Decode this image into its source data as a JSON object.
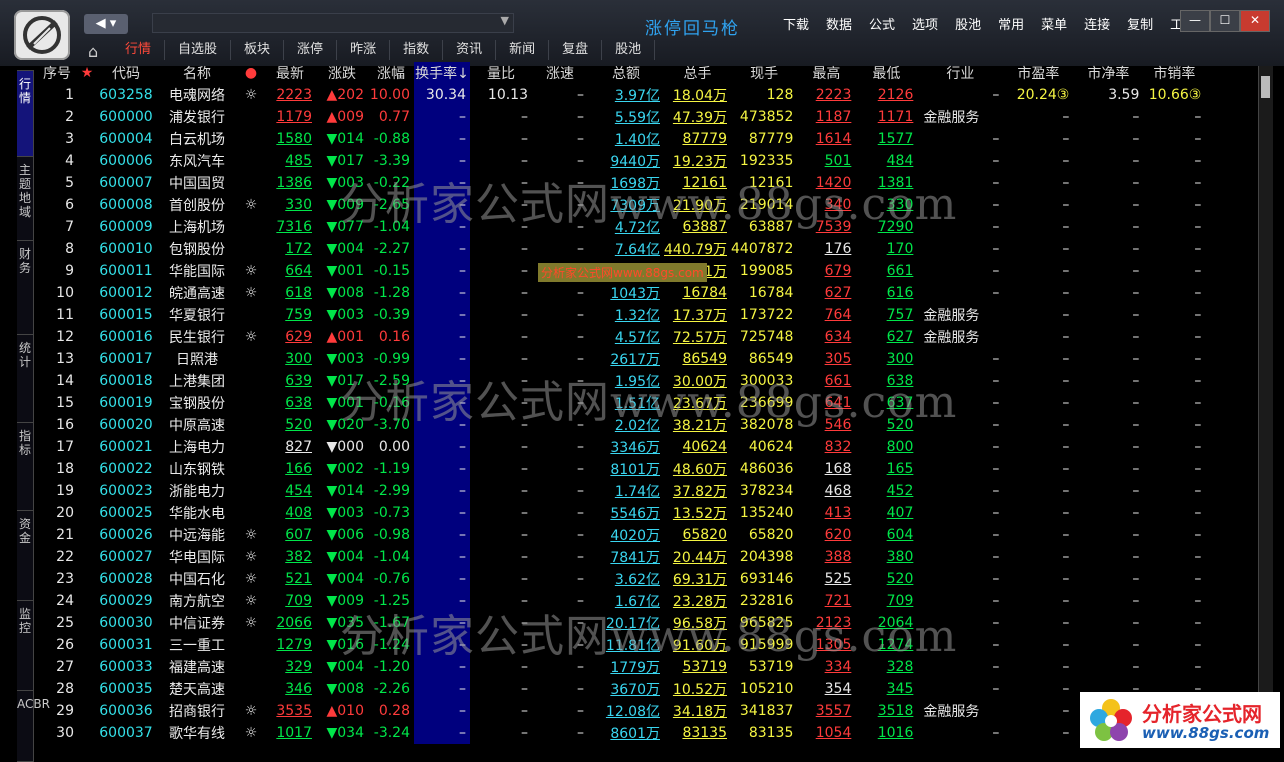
{
  "app": {
    "title": "涨停回马枪",
    "menu": [
      "下载",
      "数据",
      "公式",
      "选项",
      "股池",
      "常用",
      "菜单",
      "连接",
      "复制",
      "工具"
    ],
    "window_buttons": [
      "—",
      "☐",
      "✕"
    ],
    "nav_arrows": "◀ ▾"
  },
  "tabs": [
    {
      "label": "行情",
      "active": true
    },
    {
      "label": "自选股",
      "active": false
    },
    {
      "label": "板块",
      "active": false
    },
    {
      "label": "涨停",
      "active": false
    },
    {
      "label": "昨涨",
      "active": false
    },
    {
      "label": "指数",
      "active": false
    },
    {
      "label": "资讯",
      "active": false
    },
    {
      "label": "新闻",
      "active": false
    },
    {
      "label": "复盘",
      "active": false
    },
    {
      "label": "股池",
      "active": false
    }
  ],
  "sidebar": [
    {
      "label": "行情",
      "active": true
    },
    {
      "label": "主题地域",
      "active": false
    },
    {
      "label": "财务",
      "active": false
    },
    {
      "label": "统计",
      "active": false
    },
    {
      "label": "指标",
      "active": false
    },
    {
      "label": "资金",
      "active": false
    },
    {
      "label": "监控",
      "active": false
    },
    {
      "label": "ACBR",
      "active": false
    }
  ],
  "columns": [
    "序号",
    "★",
    "代码",
    "名称",
    "●",
    "最新",
    "涨跌",
    "涨幅",
    "换手率↓",
    "量比",
    "涨速",
    "总额",
    "总手",
    "现手",
    "最高",
    "最低",
    "行业",
    "市盈率",
    "市净率",
    "市销率"
  ],
  "rows": [
    {
      "idx": "1",
      "code": "603258",
      "name": "电魂网络",
      "mark": "☼",
      "last": "2223",
      "chg": "▲202",
      "pct": "10.00",
      "turn": "30.34",
      "vr": "10.13",
      "spd": "–",
      "amt": "3.97亿",
      "vol": "18.04万",
      "cur": "128",
      "high": "2223",
      "low": "2126",
      "ind": "–",
      "pe": "20.24③",
      "pb": "3.59",
      "ps": "10.66③",
      "dir": "up",
      "hc": "red",
      "lc": "red"
    },
    {
      "idx": "2",
      "code": "600000",
      "name": "浦发银行",
      "mark": "",
      "last": "1179",
      "chg": "▲009",
      "pct": "0.77",
      "turn": "–",
      "vr": "–",
      "spd": "–",
      "amt": "5.59亿",
      "vol": "47.39万",
      "cur": "473852",
      "high": "1187",
      "low": "1171",
      "ind": "金融服务",
      "pe": "–",
      "pb": "–",
      "ps": "–",
      "dir": "up",
      "hc": "red",
      "lc": "red"
    },
    {
      "idx": "3",
      "code": "600004",
      "name": "白云机场",
      "mark": "",
      "last": "1580",
      "chg": "▼014",
      "pct": "-0.88",
      "turn": "–",
      "vr": "–",
      "spd": "–",
      "amt": "1.40亿",
      "vol": "87779",
      "cur": "87779",
      "high": "1614",
      "low": "1577",
      "ind": "–",
      "pe": "–",
      "pb": "–",
      "ps": "–",
      "dir": "dn",
      "hc": "red",
      "lc": "grn"
    },
    {
      "idx": "4",
      "code": "600006",
      "name": "东风汽车",
      "mark": "",
      "last": "485",
      "chg": "▼017",
      "pct": "-3.39",
      "turn": "–",
      "vr": "–",
      "spd": "–",
      "amt": "9440万",
      "vol": "19.23万",
      "cur": "192335",
      "high": "501",
      "low": "484",
      "ind": "–",
      "pe": "–",
      "pb": "–",
      "ps": "–",
      "dir": "dn",
      "hc": "grn",
      "lc": "grn"
    },
    {
      "idx": "5",
      "code": "600007",
      "name": "中国国贸",
      "mark": "",
      "last": "1386",
      "chg": "▼003",
      "pct": "-0.22",
      "turn": "–",
      "vr": "–",
      "spd": "–",
      "amt": "1698万",
      "vol": "12161",
      "cur": "12161",
      "high": "1420",
      "low": "1381",
      "ind": "–",
      "pe": "–",
      "pb": "–",
      "ps": "–",
      "dir": "dn",
      "hc": "red",
      "lc": "grn"
    },
    {
      "idx": "6",
      "code": "600008",
      "name": "首创股份",
      "mark": "☼",
      "last": "330",
      "chg": "▼009",
      "pct": "-2.65",
      "turn": "–",
      "vr": "–",
      "spd": "–",
      "amt": "7309万",
      "vol": "21.90万",
      "cur": "219014",
      "high": "340",
      "low": "330",
      "ind": "–",
      "pe": "–",
      "pb": "–",
      "ps": "–",
      "dir": "dn",
      "hc": "red",
      "lc": "grn"
    },
    {
      "idx": "7",
      "code": "600009",
      "name": "上海机场",
      "mark": "",
      "last": "7316",
      "chg": "▼077",
      "pct": "-1.04",
      "turn": "–",
      "vr": "–",
      "spd": "–",
      "amt": "4.72亿",
      "vol": "63887",
      "cur": "63887",
      "high": "7539",
      "low": "7290",
      "ind": "–",
      "pe": "–",
      "pb": "–",
      "ps": "–",
      "dir": "dn",
      "hc": "red",
      "lc": "grn"
    },
    {
      "idx": "8",
      "code": "600010",
      "name": "包钢股份",
      "mark": "",
      "last": "172",
      "chg": "▼004",
      "pct": "-2.27",
      "turn": "–",
      "vr": "–",
      "spd": "–",
      "amt": "7.64亿",
      "vol": "440.79万",
      "cur": "4407872",
      "high": "176",
      "low": "170",
      "ind": "–",
      "pe": "–",
      "pb": "–",
      "ps": "–",
      "dir": "dn",
      "hc": "wht",
      "lc": "grn"
    },
    {
      "idx": "9",
      "code": "600011",
      "name": "华能国际",
      "mark": "☼",
      "last": "664",
      "chg": "▼001",
      "pct": "-0.15",
      "turn": "–",
      "vr": "–",
      "spd": "–",
      "amt": "1.33亿",
      "vol": "19.91万",
      "cur": "199085",
      "high": "679",
      "low": "661",
      "ind": "–",
      "pe": "–",
      "pb": "–",
      "ps": "–",
      "dir": "dn",
      "hc": "red",
      "lc": "grn"
    },
    {
      "idx": "10",
      "code": "600012",
      "name": "皖通高速",
      "mark": "☼",
      "last": "618",
      "chg": "▼008",
      "pct": "-1.28",
      "turn": "–",
      "vr": "–",
      "spd": "–",
      "amt": "1043万",
      "vol": "16784",
      "cur": "16784",
      "high": "627",
      "low": "616",
      "ind": "–",
      "pe": "–",
      "pb": "–",
      "ps": "–",
      "dir": "dn",
      "hc": "red",
      "lc": "grn"
    },
    {
      "idx": "11",
      "code": "600015",
      "name": "华夏银行",
      "mark": "",
      "last": "759",
      "chg": "▼003",
      "pct": "-0.39",
      "turn": "–",
      "vr": "–",
      "spd": "–",
      "amt": "1.32亿",
      "vol": "17.37万",
      "cur": "173722",
      "high": "764",
      "low": "757",
      "ind": "金融服务",
      "pe": "–",
      "pb": "–",
      "ps": "–",
      "dir": "dn",
      "hc": "red",
      "lc": "grn"
    },
    {
      "idx": "12",
      "code": "600016",
      "name": "民生银行",
      "mark": "☼",
      "last": "629",
      "chg": "▲001",
      "pct": "0.16",
      "turn": "–",
      "vr": "–",
      "spd": "–",
      "amt": "4.57亿",
      "vol": "72.57万",
      "cur": "725748",
      "high": "634",
      "low": "627",
      "ind": "金融服务",
      "pe": "–",
      "pb": "–",
      "ps": "–",
      "dir": "up",
      "hc": "red",
      "lc": "grn"
    },
    {
      "idx": "13",
      "code": "600017",
      "name": "日照港",
      "mark": "",
      "last": "300",
      "chg": "▼003",
      "pct": "-0.99",
      "turn": "–",
      "vr": "–",
      "spd": "–",
      "amt": "2617万",
      "vol": "86549",
      "cur": "86549",
      "high": "305",
      "low": "300",
      "ind": "–",
      "pe": "–",
      "pb": "–",
      "ps": "–",
      "dir": "dn",
      "hc": "red",
      "lc": "grn"
    },
    {
      "idx": "14",
      "code": "600018",
      "name": "上港集团",
      "mark": "",
      "last": "639",
      "chg": "▼017",
      "pct": "-2.59",
      "turn": "–",
      "vr": "–",
      "spd": "–",
      "amt": "1.95亿",
      "vol": "30.00万",
      "cur": "300033",
      "high": "661",
      "low": "638",
      "ind": "–",
      "pe": "–",
      "pb": "–",
      "ps": "–",
      "dir": "dn",
      "hc": "red",
      "lc": "grn"
    },
    {
      "idx": "15",
      "code": "600019",
      "name": "宝钢股份",
      "mark": "",
      "last": "638",
      "chg": "▼001",
      "pct": "-0.16",
      "turn": "–",
      "vr": "–",
      "spd": "–",
      "amt": "1.51亿",
      "vol": "23.67万",
      "cur": "236699",
      "high": "641",
      "low": "637",
      "ind": "–",
      "pe": "–",
      "pb": "–",
      "ps": "–",
      "dir": "dn",
      "hc": "red",
      "lc": "grn"
    },
    {
      "idx": "16",
      "code": "600020",
      "name": "中原高速",
      "mark": "",
      "last": "520",
      "chg": "▼020",
      "pct": "-3.70",
      "turn": "–",
      "vr": "–",
      "spd": "–",
      "amt": "2.02亿",
      "vol": "38.21万",
      "cur": "382078",
      "high": "546",
      "low": "520",
      "ind": "–",
      "pe": "–",
      "pb": "–",
      "ps": "–",
      "dir": "dn",
      "hc": "red",
      "lc": "grn"
    },
    {
      "idx": "17",
      "code": "600021",
      "name": "上海电力",
      "mark": "",
      "last": "827",
      "chg": "▼000",
      "pct": "0.00",
      "turn": "–",
      "vr": "–",
      "spd": "–",
      "amt": "3346万",
      "vol": "40624",
      "cur": "40624",
      "high": "832",
      "low": "800",
      "ind": "–",
      "pe": "–",
      "pb": "–",
      "ps": "–",
      "dir": "eq",
      "hc": "red",
      "lc": "grn"
    },
    {
      "idx": "18",
      "code": "600022",
      "name": "山东钢铁",
      "mark": "",
      "last": "166",
      "chg": "▼002",
      "pct": "-1.19",
      "turn": "–",
      "vr": "–",
      "spd": "–",
      "amt": "8101万",
      "vol": "48.60万",
      "cur": "486036",
      "high": "168",
      "low": "165",
      "ind": "–",
      "pe": "–",
      "pb": "–",
      "ps": "–",
      "dir": "dn",
      "hc": "wht",
      "lc": "grn"
    },
    {
      "idx": "19",
      "code": "600023",
      "name": "浙能电力",
      "mark": "",
      "last": "454",
      "chg": "▼014",
      "pct": "-2.99",
      "turn": "–",
      "vr": "–",
      "spd": "–",
      "amt": "1.74亿",
      "vol": "37.82万",
      "cur": "378234",
      "high": "468",
      "low": "452",
      "ind": "–",
      "pe": "–",
      "pb": "–",
      "ps": "–",
      "dir": "dn",
      "hc": "wht",
      "lc": "grn"
    },
    {
      "idx": "20",
      "code": "600025",
      "name": "华能水电",
      "mark": "",
      "last": "408",
      "chg": "▼003",
      "pct": "-0.73",
      "turn": "–",
      "vr": "–",
      "spd": "–",
      "amt": "5546万",
      "vol": "13.52万",
      "cur": "135240",
      "high": "413",
      "low": "407",
      "ind": "–",
      "pe": "–",
      "pb": "–",
      "ps": "–",
      "dir": "dn",
      "hc": "red",
      "lc": "grn"
    },
    {
      "idx": "21",
      "code": "600026",
      "name": "中远海能",
      "mark": "☼",
      "last": "607",
      "chg": "▼006",
      "pct": "-0.98",
      "turn": "–",
      "vr": "–",
      "spd": "–",
      "amt": "4020万",
      "vol": "65820",
      "cur": "65820",
      "high": "620",
      "low": "604",
      "ind": "–",
      "pe": "–",
      "pb": "–",
      "ps": "–",
      "dir": "dn",
      "hc": "red",
      "lc": "grn"
    },
    {
      "idx": "22",
      "code": "600027",
      "name": "华电国际",
      "mark": "☼",
      "last": "382",
      "chg": "▼004",
      "pct": "-1.04",
      "turn": "–",
      "vr": "–",
      "spd": "–",
      "amt": "7841万",
      "vol": "20.44万",
      "cur": "204398",
      "high": "388",
      "low": "380",
      "ind": "–",
      "pe": "–",
      "pb": "–",
      "ps": "–",
      "dir": "dn",
      "hc": "red",
      "lc": "grn"
    },
    {
      "idx": "23",
      "code": "600028",
      "name": "中国石化",
      "mark": "☼",
      "last": "521",
      "chg": "▼004",
      "pct": "-0.76",
      "turn": "–",
      "vr": "–",
      "spd": "–",
      "amt": "3.62亿",
      "vol": "69.31万",
      "cur": "693146",
      "high": "525",
      "low": "520",
      "ind": "–",
      "pe": "–",
      "pb": "–",
      "ps": "–",
      "dir": "dn",
      "hc": "wht",
      "lc": "grn"
    },
    {
      "idx": "24",
      "code": "600029",
      "name": "南方航空",
      "mark": "☼",
      "last": "709",
      "chg": "▼009",
      "pct": "-1.25",
      "turn": "–",
      "vr": "–",
      "spd": "–",
      "amt": "1.67亿",
      "vol": "23.28万",
      "cur": "232816",
      "high": "721",
      "low": "709",
      "ind": "–",
      "pe": "–",
      "pb": "–",
      "ps": "–",
      "dir": "dn",
      "hc": "red",
      "lc": "grn"
    },
    {
      "idx": "25",
      "code": "600030",
      "name": "中信证券",
      "mark": "☼",
      "last": "2066",
      "chg": "▼035",
      "pct": "-1.67",
      "turn": "–",
      "vr": "–",
      "spd": "–",
      "amt": "20.17亿",
      "vol": "96.58万",
      "cur": "965825",
      "high": "2123",
      "low": "2064",
      "ind": "–",
      "pe": "–",
      "pb": "–",
      "ps": "–",
      "dir": "dn",
      "hc": "red",
      "lc": "grn"
    },
    {
      "idx": "26",
      "code": "600031",
      "name": "三一重工",
      "mark": "",
      "last": "1279",
      "chg": "▼016",
      "pct": "-1.24",
      "turn": "–",
      "vr": "–",
      "spd": "–",
      "amt": "11.81亿",
      "vol": "91.60万",
      "cur": "915999",
      "high": "1305",
      "low": "1274",
      "ind": "–",
      "pe": "–",
      "pb": "–",
      "ps": "–",
      "dir": "dn",
      "hc": "red",
      "lc": "grn"
    },
    {
      "idx": "27",
      "code": "600033",
      "name": "福建高速",
      "mark": "",
      "last": "329",
      "chg": "▼004",
      "pct": "-1.20",
      "turn": "–",
      "vr": "–",
      "spd": "–",
      "amt": "1779万",
      "vol": "53719",
      "cur": "53719",
      "high": "334",
      "low": "328",
      "ind": "–",
      "pe": "–",
      "pb": "–",
      "ps": "–",
      "dir": "dn",
      "hc": "red",
      "lc": "grn"
    },
    {
      "idx": "28",
      "code": "600035",
      "name": "楚天高速",
      "mark": "",
      "last": "346",
      "chg": "▼008",
      "pct": "-2.26",
      "turn": "–",
      "vr": "–",
      "spd": "–",
      "amt": "3670万",
      "vol": "10.52万",
      "cur": "105210",
      "high": "354",
      "low": "345",
      "ind": "–",
      "pe": "–",
      "pb": "–",
      "ps": "–",
      "dir": "dn",
      "hc": "wht",
      "lc": "grn"
    },
    {
      "idx": "29",
      "code": "600036",
      "name": "招商银行",
      "mark": "☼",
      "last": "3535",
      "chg": "▲010",
      "pct": "0.28",
      "turn": "–",
      "vr": "–",
      "spd": "–",
      "amt": "12.08亿",
      "vol": "34.18万",
      "cur": "341837",
      "high": "3557",
      "low": "3518",
      "ind": "金融服务",
      "pe": "–",
      "pb": "–",
      "ps": "–",
      "dir": "up",
      "hc": "red",
      "lc": "grn"
    },
    {
      "idx": "30",
      "code": "600037",
      "name": "歌华有线",
      "mark": "☼",
      "last": "1017",
      "chg": "▼034",
      "pct": "-3.24",
      "turn": "–",
      "vr": "–",
      "spd": "–",
      "amt": "8601万",
      "vol": "83135",
      "cur": "83135",
      "high": "1054",
      "low": "1016",
      "ind": "–",
      "pe": "–",
      "pb": "–",
      "ps": "–",
      "dir": "dn",
      "hc": "red",
      "lc": "grn"
    }
  ],
  "watermark": {
    "text": "分析家公式网www.88gs.com",
    "small": "分析家公式网www.88gs.com"
  },
  "brand": {
    "name": "分析家公式网",
    "url": "www.88gs.com"
  },
  "colors": {
    "up": "#ff3b3b",
    "down": "#00e64a",
    "code": "#34e0e8",
    "highlight_column": "#00007e",
    "title": "#2fa3f0"
  }
}
